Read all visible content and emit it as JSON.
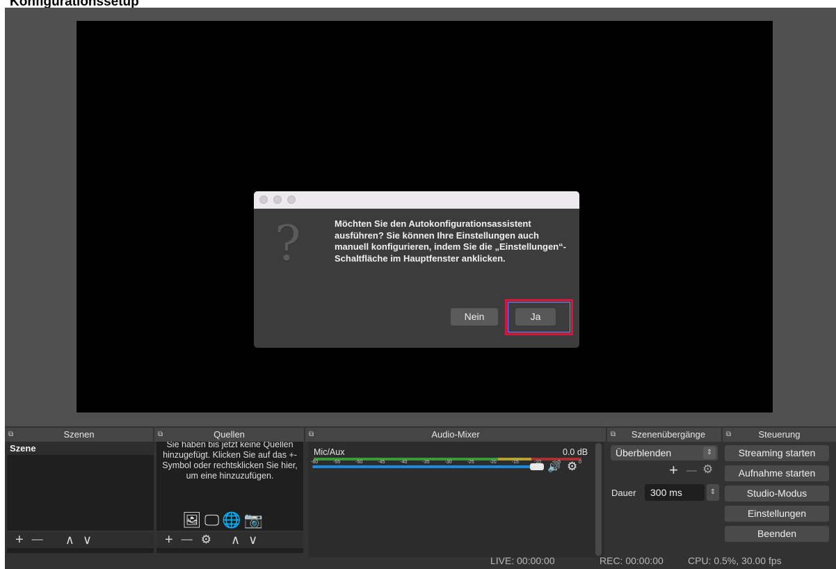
{
  "page_title": "Konfigurationssetup",
  "dialog": {
    "question_icon": "?",
    "message": "Möchten Sie den Autokonfigurationsassistent ausführen? Sie können Ihre Einstellungen auch manuell konfigurieren, indem Sie die „Einstellungen“-Schaltfläche im Hauptfenster anklicken.",
    "no_label": "Nein",
    "yes_label": "Ja"
  },
  "docks": {
    "scenes": {
      "title": "Szenen",
      "items": [
        "Szene"
      ],
      "toolbar": [
        "+",
        "—",
        "∧",
        "∨"
      ]
    },
    "sources": {
      "title": "Quellen",
      "hint": "Sie haben bis jetzt keine Quellen hinzugefügt. Klicken Sie auf das +-Symbol oder rechtsklicken Sie hier, um eine hinzuzufügen.",
      "toolbar": [
        "+",
        "—",
        "⚙",
        "∧",
        "∨"
      ]
    },
    "mixer": {
      "title": "Audio-Mixer",
      "channel": "Mic/Aux",
      "db": "0.0 dB",
      "ticks": [
        "-60",
        "-55",
        "-50",
        "-45",
        "-40",
        "-35",
        "-30",
        "-25",
        "-20",
        "-15",
        "-10",
        "-5",
        "0"
      ],
      "volume": 1.0
    },
    "transitions": {
      "title": "Szenenübergänge",
      "selected": "Überblenden",
      "duration_label": "Dauer",
      "duration_value": "300 ms"
    },
    "controls": {
      "title": "Steuerung",
      "buttons": [
        "Streaming starten",
        "Aufnahme starten",
        "Studio-Modus",
        "Einstellungen",
        "Beenden"
      ]
    }
  },
  "status": {
    "live": "LIVE: 00:00:00",
    "rec": "REC: 00:00:00",
    "cpu": "CPU: 0.5%, 30.00 fps"
  },
  "colors": {
    "highlight_border": "#d8153a",
    "volume_bar": "#1a8ce0"
  }
}
